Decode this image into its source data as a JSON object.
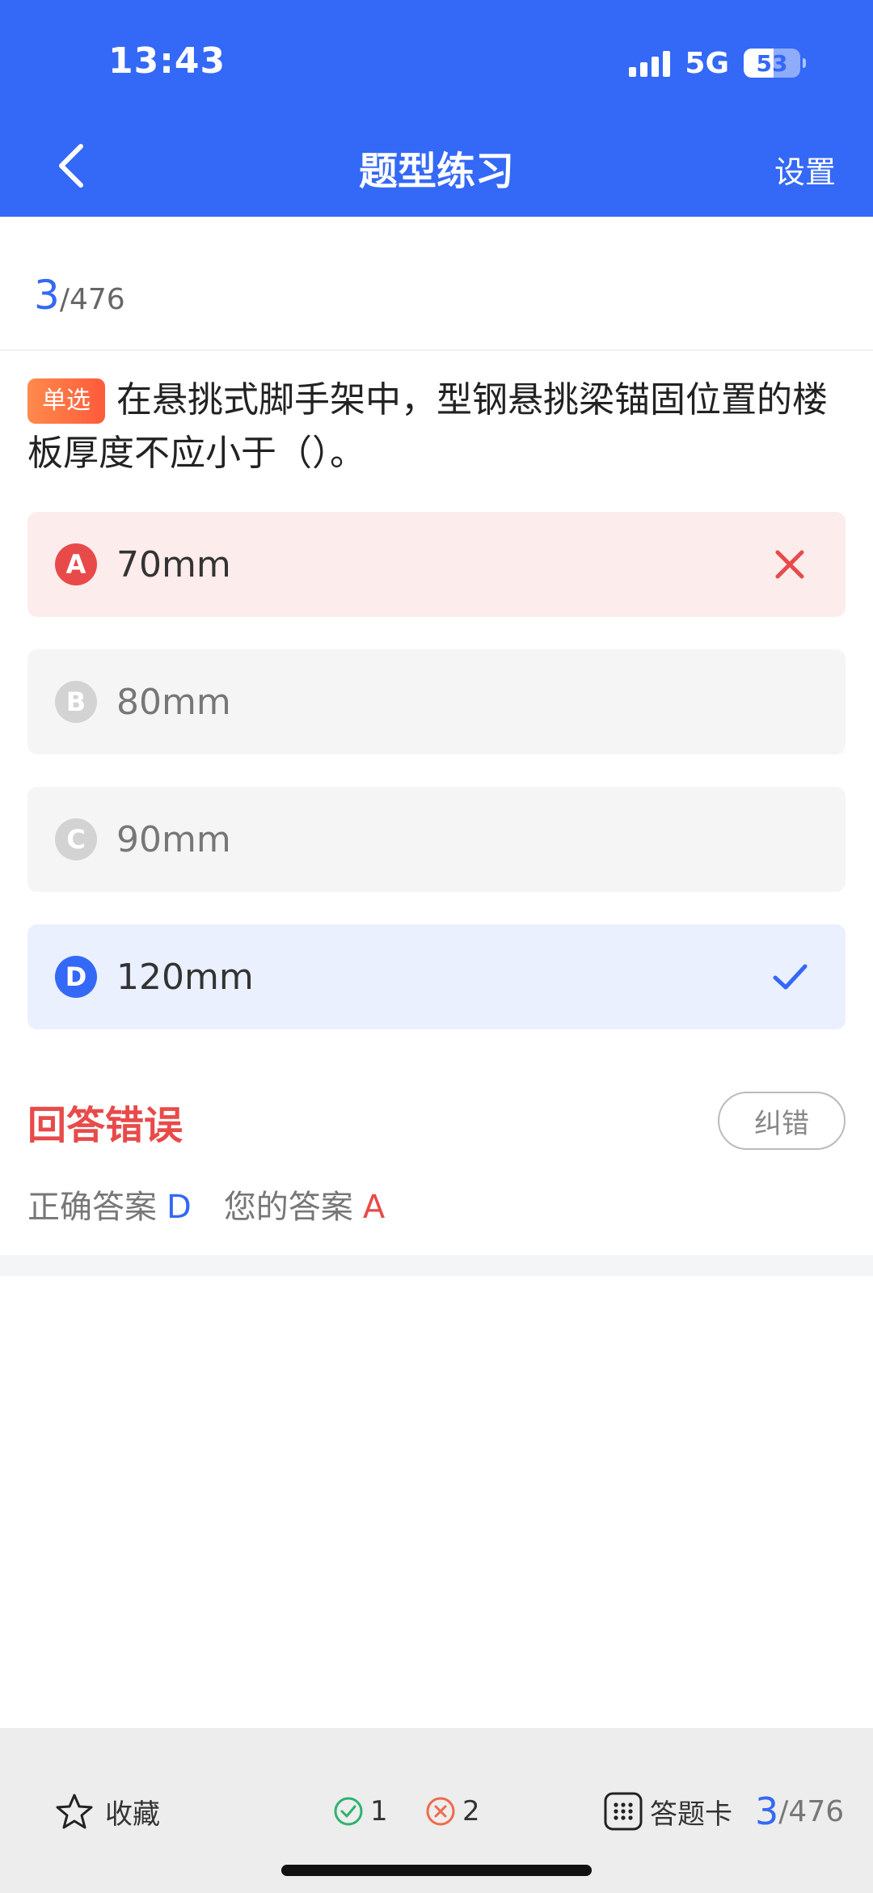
{
  "status_bar": {
    "time": "13:43",
    "network": "5G",
    "battery": "53"
  },
  "nav": {
    "title": "题型练习",
    "settings_label": "设置"
  },
  "progress": {
    "current": "3",
    "total": "/476"
  },
  "question": {
    "type_label": "单选",
    "text": "在悬挑式脚手架中，型钢悬挑梁锚固位置的楼板厚度不应小于（）。"
  },
  "options": [
    {
      "letter": "A",
      "text": "70mm",
      "state": "wrong"
    },
    {
      "letter": "B",
      "text": "80mm",
      "state": "normal"
    },
    {
      "letter": "C",
      "text": "90mm",
      "state": "normal"
    },
    {
      "letter": "D",
      "text": "120mm",
      "state": "correct"
    }
  ],
  "result": {
    "title": "回答错误",
    "report_label": "纠错",
    "correct_label": "正确答案",
    "correct_value": "D",
    "your_label": "您的答案",
    "your_value": "A"
  },
  "bottom_bar": {
    "favorite_label": "收藏",
    "right_count": "1",
    "wrong_count": "2",
    "answer_card_label": "答题卡",
    "page_current": "3",
    "page_total": "/476"
  },
  "colors": {
    "primary": "#3468F6",
    "error": "#E84A4A",
    "success": "#2DB36E"
  }
}
